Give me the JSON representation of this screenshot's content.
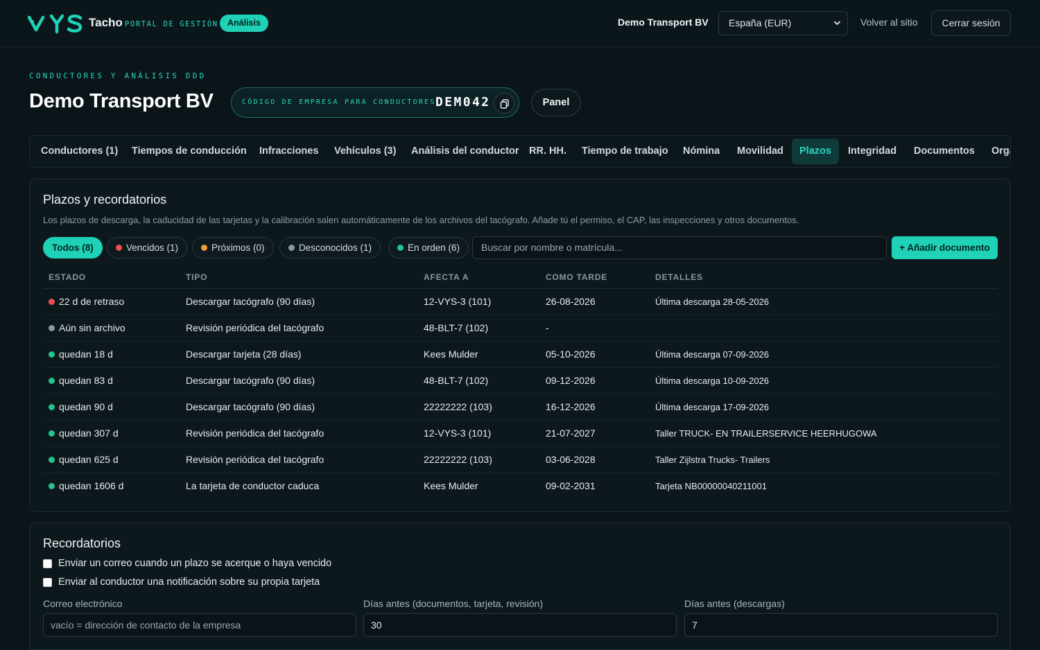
{
  "header": {
    "brand_name": "Tacho",
    "brand_sub": "PORTAL DE GESTIÓN",
    "badge": "Análisis",
    "company": "Demo Transport BV",
    "region_select": "España (EUR)",
    "back_link": "Volver al sitio",
    "logout": "Cerrar sesión"
  },
  "page": {
    "eyebrow": "CONDUCTORES Y ANÁLISIS DDD",
    "title": "Demo Transport BV",
    "code_label": "CÓDIGO DE EMPRESA PARA CONDUCTORES",
    "code_value": "DEM042",
    "panel_button": "Panel"
  },
  "tabs": [
    {
      "label": "Conductores (1)"
    },
    {
      "label": "Tiempos de conducción"
    },
    {
      "label": "Infracciones"
    },
    {
      "label": "Vehículos (3)"
    },
    {
      "label": "Análisis del conductor"
    },
    {
      "label": "RR. HH."
    },
    {
      "label": "Tiempo de trabajo"
    },
    {
      "label": "Nómina"
    },
    {
      "label": "Movilidad"
    },
    {
      "label": "Plazos",
      "active": true
    },
    {
      "label": "Integridad"
    },
    {
      "label": "Documentos"
    },
    {
      "label": "Organización"
    }
  ],
  "deadlines": {
    "title": "Plazos y recordatorios",
    "description": "Los plazos de descarga, la caducidad de las tarjetas y la calibración salen automáticamente de los archivos del tacógrafo. Añade tú el permiso, el CAP, las inspecciones y otros documentos.",
    "filters": [
      {
        "label": "Todos (8)",
        "dot": null,
        "active": true
      },
      {
        "label": "Vencidos (1)",
        "dot": "red"
      },
      {
        "label": "Próximos (0)",
        "dot": "orange"
      },
      {
        "label": "Desconocidos (1)",
        "dot": "grey"
      },
      {
        "label": "En orden (6)",
        "dot": "green"
      }
    ],
    "search_placeholder": "Buscar por nombre o matrícula...",
    "add_button": "+ Añadir documento",
    "columns": [
      "ESTADO",
      "TIPO",
      "AFECTA A",
      "COMO TARDE",
      "DETALLES"
    ],
    "rows": [
      {
        "status": "22 d de retraso",
        "dot": "red",
        "type": "Descargar tacógrafo (90 días)",
        "affects": "12-VYS-3 (101)",
        "due": "26-08-2026",
        "details": "Última descarga 28-05-2026"
      },
      {
        "status": "Aún sin archivo",
        "dot": "grey",
        "type": "Revisión periódica del tacógrafo",
        "affects": "48-BLT-7 (102)",
        "due": "-",
        "details": ""
      },
      {
        "status": "quedan 18 d",
        "dot": "green",
        "type": "Descargar tarjeta (28 días)",
        "affects": "Kees Mulder",
        "due": "05-10-2026",
        "details": "Última descarga 07-09-2026"
      },
      {
        "status": "quedan 83 d",
        "dot": "green",
        "type": "Descargar tacógrafo (90 días)",
        "affects": "48-BLT-7 (102)",
        "due": "09-12-2026",
        "details": "Última descarga 10-09-2026"
      },
      {
        "status": "quedan 90 d",
        "dot": "green",
        "type": "Descargar tacógrafo (90 días)",
        "affects": "22222222 (103)",
        "due": "16-12-2026",
        "details": "Última descarga 17-09-2026"
      },
      {
        "status": "quedan 307 d",
        "dot": "green",
        "type": "Revisión periódica del tacógrafo",
        "affects": "12-VYS-3 (101)",
        "due": "21-07-2027",
        "details": "Taller TRUCK- EN TRAILERSERVICE HEERHUGOWA"
      },
      {
        "status": "quedan 625 d",
        "dot": "green",
        "type": "Revisión periódica del tacógrafo",
        "affects": "22222222 (103)",
        "due": "03-06-2028",
        "details": "Taller Zijlstra Trucks- Trailers"
      },
      {
        "status": "quedan 1606 d",
        "dot": "green",
        "type": "La tarjeta de conductor caduca",
        "affects": "Kees Mulder",
        "due": "09-02-2031",
        "details": "Tarjeta NB00000040211001"
      }
    ]
  },
  "reminders": {
    "title": "Recordatorios",
    "checkbox_email": "Enviar un correo cuando un plazo se acerque o haya vencido",
    "checkbox_driver": "Enviar al conductor una notificación sobre su propia tarjeta",
    "email_label": "Correo electrónico",
    "email_placeholder": "vacío = dirección de contacto de la empresa",
    "days_docs_label": "Días antes (documentos, tarjeta, revisión)",
    "days_docs_value": "30",
    "days_downloads_label": "Días antes (descargas)",
    "days_downloads_value": "7"
  },
  "colors": {
    "accent": "#1fd1b6",
    "background": "#0a1419",
    "status_red": "#ef4d4d",
    "status_orange": "#f0a030",
    "status_grey": "#8a9aa0",
    "status_green": "#22c58e"
  }
}
